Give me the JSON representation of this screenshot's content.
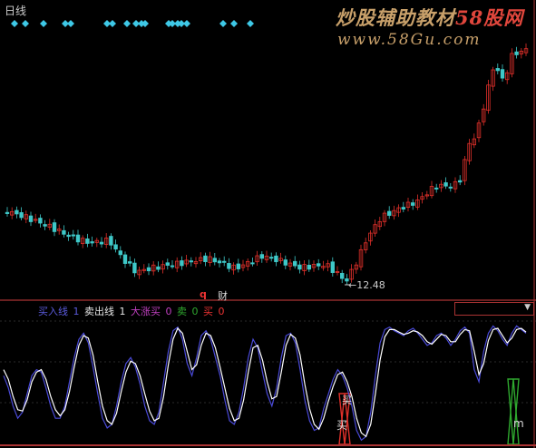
{
  "header": {
    "period_label": "日线"
  },
  "watermark": {
    "prefix": "炒股辅助教材",
    "brand": "58股网",
    "url": "www.58Gu.com"
  },
  "price_chart": {
    "low_annotation": "←12.48",
    "marker_q": "q",
    "marker_cai": "财",
    "up_color": "#e0302a",
    "down_color": "#3ec8c8",
    "diamond_color": "#3ec8e6"
  },
  "indicator": {
    "legend": [
      {
        "label": "买入线",
        "value": "1"
      },
      {
        "label": "卖出线",
        "value": "1"
      },
      {
        "label": "大涨买",
        "value": "0"
      },
      {
        "label": "卖",
        "value": "0"
      },
      {
        "label": "买",
        "value": "0"
      }
    ],
    "signal_label_top": "买",
    "signal_label_bottom": "买",
    "signal_label_m": "m",
    "buy_line_color": "#4a4ad8",
    "sell_line_color": "#ffffff",
    "buy_bar_color": "#e0302a",
    "sell_bar_color": "#2fa82f"
  },
  "chart_data": {
    "type": "line",
    "title": "",
    "series": [
      {
        "name": "买入线",
        "values": [
          0.55,
          0.45,
          0.3,
          0.2,
          0.25,
          0.4,
          0.55,
          0.6,
          0.58,
          0.45,
          0.3,
          0.2,
          0.2,
          0.3,
          0.5,
          0.7,
          0.85,
          0.9,
          0.82,
          0.62,
          0.4,
          0.2,
          0.12,
          0.15,
          0.3,
          0.5,
          0.65,
          0.7,
          0.62,
          0.48,
          0.3,
          0.18,
          0.15,
          0.25,
          0.5,
          0.75,
          0.92,
          0.95,
          0.85,
          0.65,
          0.55,
          0.7,
          0.88,
          0.92,
          0.85,
          0.7,
          0.55,
          0.35,
          0.18,
          0.15,
          0.25,
          0.45,
          0.7,
          0.85,
          0.78,
          0.58,
          0.4,
          0.3,
          0.45,
          0.7,
          0.88,
          0.9,
          0.82,
          0.6,
          0.35,
          0.18,
          0.1,
          0.12,
          0.28,
          0.4,
          0.52,
          0.6,
          0.55,
          0.45,
          0.3,
          0.1,
          0.02,
          0.05,
          0.25,
          0.55,
          0.82,
          0.93,
          0.95,
          0.92,
          0.9,
          0.88,
          0.92,
          0.94,
          0.9,
          0.85,
          0.8,
          0.82,
          0.88,
          0.9,
          0.86,
          0.8,
          0.85,
          0.92,
          0.95,
          0.9,
          0.6,
          0.5,
          0.75,
          0.9,
          0.96,
          0.92,
          0.85,
          0.8,
          0.9,
          0.96,
          0.93,
          0.9
        ]
      },
      {
        "name": "卖出线",
        "values": [
          0.6,
          0.52,
          0.38,
          0.27,
          0.26,
          0.35,
          0.5,
          0.58,
          0.6,
          0.52,
          0.38,
          0.27,
          0.22,
          0.27,
          0.42,
          0.62,
          0.8,
          0.88,
          0.86,
          0.72,
          0.5,
          0.3,
          0.18,
          0.15,
          0.24,
          0.42,
          0.58,
          0.67,
          0.65,
          0.55,
          0.4,
          0.26,
          0.18,
          0.2,
          0.38,
          0.64,
          0.85,
          0.94,
          0.9,
          0.75,
          0.6,
          0.64,
          0.8,
          0.9,
          0.88,
          0.78,
          0.62,
          0.45,
          0.28,
          0.18,
          0.2,
          0.35,
          0.58,
          0.78,
          0.8,
          0.68,
          0.5,
          0.36,
          0.38,
          0.58,
          0.8,
          0.89,
          0.86,
          0.72,
          0.48,
          0.28,
          0.15,
          0.11,
          0.2,
          0.34,
          0.46,
          0.56,
          0.58,
          0.5,
          0.38,
          0.2,
          0.08,
          0.05,
          0.15,
          0.4,
          0.68,
          0.87,
          0.93,
          0.93,
          0.91,
          0.89,
          0.9,
          0.92,
          0.91,
          0.88,
          0.83,
          0.81,
          0.85,
          0.89,
          0.88,
          0.83,
          0.83,
          0.89,
          0.93,
          0.92,
          0.75,
          0.56,
          0.65,
          0.84,
          0.93,
          0.94,
          0.88,
          0.82,
          0.86,
          0.93,
          0.94,
          0.91
        ]
      }
    ]
  }
}
